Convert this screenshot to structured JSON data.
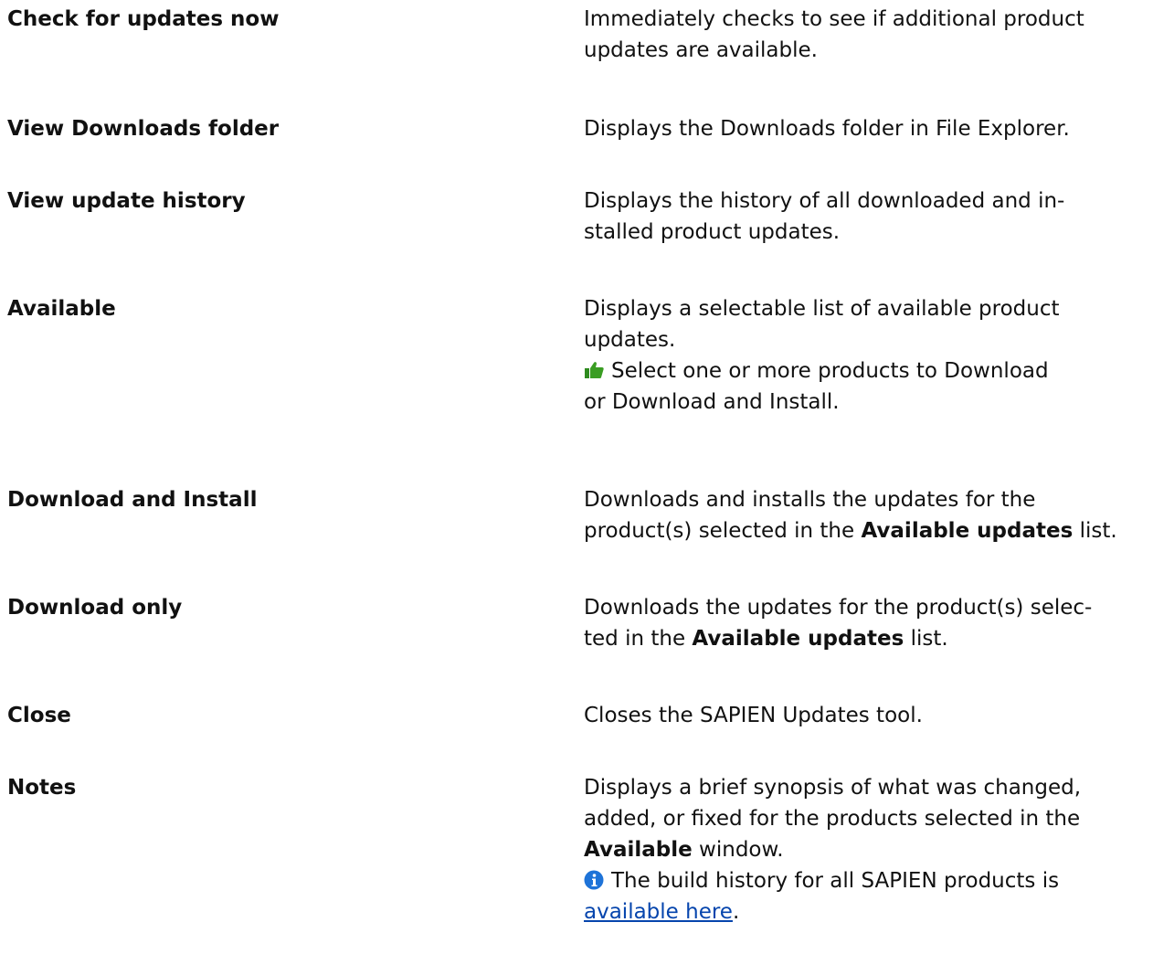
{
  "rows": [
    {
      "term": "Check for updates now",
      "desc": "Immediately checks to see if additional product updates are available."
    },
    {
      "term": "View Downloads folder",
      "desc": "Displays the Downloads folder in File Explorer."
    },
    {
      "term": "View update history",
      "desc_line1": "Displays the history of all downloaded and in-",
      "desc_line2": "stalled product updates."
    },
    {
      "term": "Available",
      "desc": "Displays a selectable list of available product updates.",
      "tip_line1": "Select one or more products to Download",
      "tip_line2": "or Download and Install.",
      "tip_icon": "thumbs-up-icon"
    },
    {
      "term": "Download and Install",
      "desc_pre": "Downloads and installs the updates for the product(s) selected in the ",
      "desc_bold": "Available updates",
      "desc_post": " list."
    },
    {
      "term": "Download only",
      "desc_line1": "Downloads the updates for the product(s) selec-",
      "desc_line2_pre": "ted in the ",
      "desc_bold": "Available updates",
      "desc_post": " list."
    },
    {
      "term": "Close",
      "desc": "Closes the SAPIEN Updates tool."
    },
    {
      "term": "Notes",
      "desc_pre": "Displays a brief synopsis of what was changed, added, or fixed for the products selected in the ",
      "desc_bold": "Available",
      "desc_post": " window.",
      "info_text": "The build history for all SAPIEN products is",
      "link_text": "available here",
      "link_post": ".",
      "info_icon": "info-icon"
    }
  ],
  "colors": {
    "text": "#111111",
    "link": "#0645ad",
    "thumb_green": "#2e8b1f",
    "info_blue": "#1e73d8"
  }
}
